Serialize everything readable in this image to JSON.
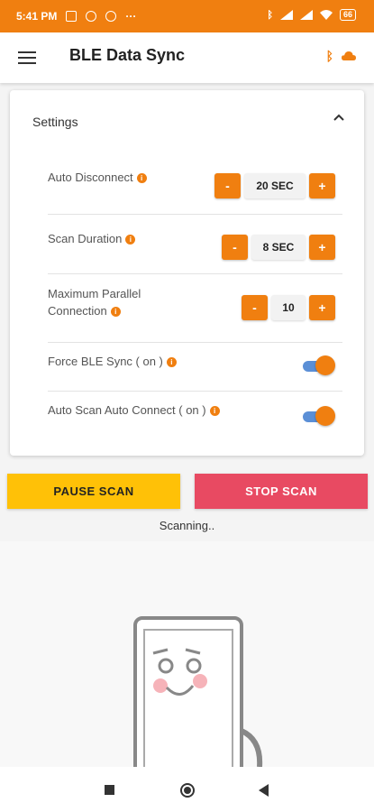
{
  "status_bar": {
    "time": "5:41 PM",
    "battery": "66",
    "left_icons": [
      "message-icon",
      "grid-icon",
      "grid-icon",
      "more-dots-icon"
    ],
    "right_icons": [
      "bluetooth-icon",
      "signal-icon",
      "signal-icon",
      "wifi-icon",
      "battery-icon"
    ]
  },
  "app_bar": {
    "title": "BLE Data Sync",
    "icons": [
      "menu-icon",
      "bluetooth-icon",
      "cloud-icon"
    ]
  },
  "settings": {
    "title": "Settings",
    "rows": [
      {
        "label": "Auto Disconnect",
        "value": "20 SEC",
        "minus": "-",
        "plus": "+"
      },
      {
        "label": "Scan Duration",
        "value": "8 SEC",
        "minus": "-",
        "plus": "+"
      },
      {
        "label_line1": "Maximum Parallel",
        "label_line2": "Connection",
        "value": "10",
        "minus": "-",
        "plus": "+"
      },
      {
        "label": "Force BLE Sync ( on )",
        "toggle": true
      },
      {
        "label": "Auto Scan Auto Connect ( on )",
        "toggle": true
      }
    ],
    "info_glyph": "i"
  },
  "actions": {
    "pause_label": "PAUSE SCAN",
    "stop_label": "STOP SCAN"
  },
  "status_text": "Scanning..",
  "colors": {
    "accent": "#f07f10",
    "pause": "#ffc107",
    "stop": "#e84a62",
    "toggle_track": "#5b8fd6"
  }
}
